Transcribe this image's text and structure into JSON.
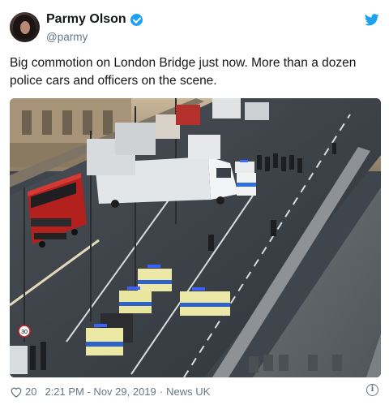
{
  "author": {
    "display_name": "Parmy Olson",
    "handle": "@parmy",
    "verified": true,
    "avatar_icon": "profile-photo"
  },
  "brand": {
    "icon": "twitter-bird-icon",
    "color": "#1da1f2"
  },
  "tweet": {
    "text": "Big commotion on London Bridge just now. More than a dozen\npolice cars and officers on the scene."
  },
  "media": {
    "type": "photo",
    "speed_sign": "30"
  },
  "footer": {
    "like_icon": "heart-icon",
    "likes": "20",
    "timestamp": "2:21 PM - Nov 29, 2019",
    "separator": "·",
    "source": "News UK",
    "info_icon": "info-icon",
    "info_glyph": "i"
  },
  "colors": {
    "text": "#14171a",
    "secondary": "#657786",
    "accent": "#1da1f2"
  }
}
